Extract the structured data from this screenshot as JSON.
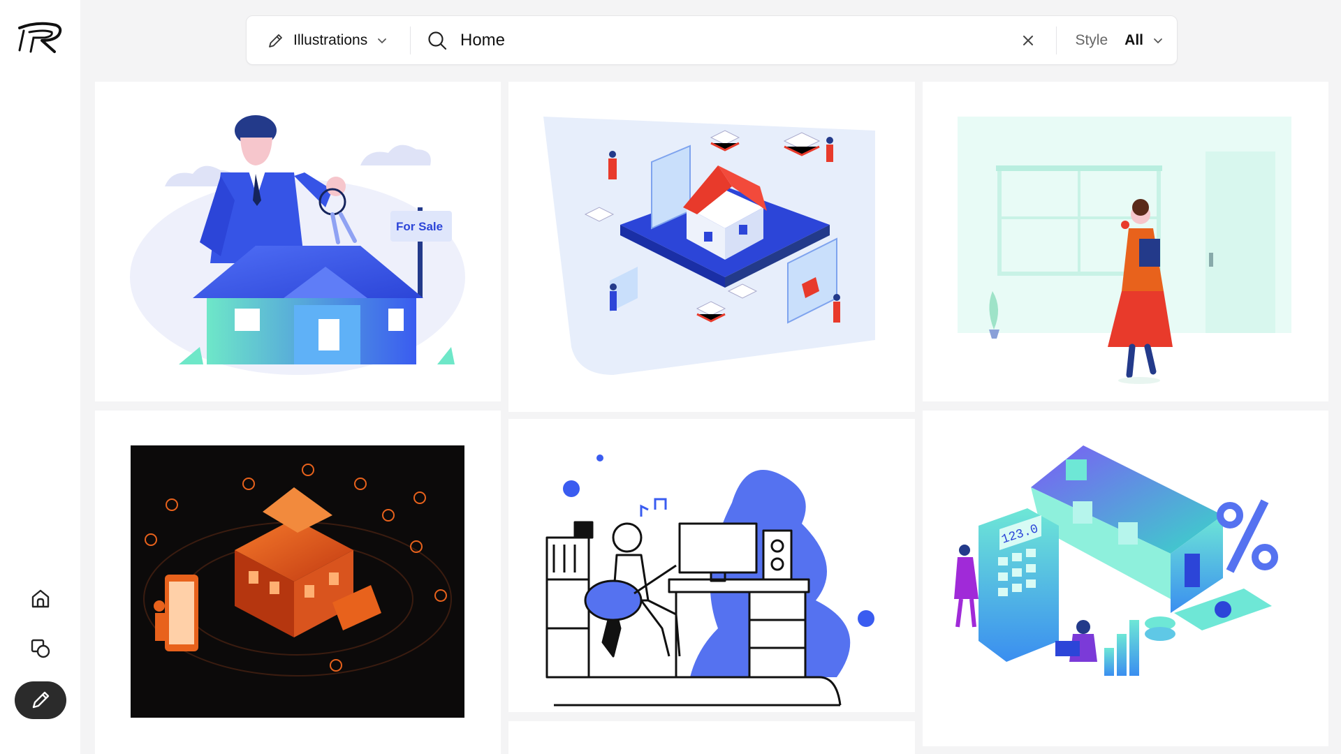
{
  "app": {
    "logo_icon": "brand-logo-icon"
  },
  "sidebar": {
    "items": [
      {
        "name": "home",
        "icon": "home-icon",
        "active": false
      },
      {
        "name": "shapes",
        "icon": "shapes-icon",
        "active": false
      },
      {
        "name": "draw",
        "icon": "pencil-icon",
        "active": true
      }
    ],
    "active_bg": "#2b2b2b"
  },
  "search": {
    "category_icon": "pencil-icon",
    "category_label": "Illustrations",
    "query": "Home",
    "style_label": "Style",
    "style_value": "All"
  },
  "results": {
    "cards": [
      {
        "id": "card-1",
        "text": "For Sale",
        "illustration": "businessman-holding-keys-house-for-sale"
      },
      {
        "id": "card-2",
        "illustration": "isometric-house-on-tablet-with-people"
      },
      {
        "id": "card-3",
        "illustration": "woman-in-red-dress-at-home-window"
      },
      {
        "id": "card-4",
        "illustration": "dark-isometric-smart-home"
      },
      {
        "id": "card-5",
        "illustration": "girl-playing-guitar-at-desk-outline"
      },
      {
        "id": "card-6",
        "text": "123.0",
        "illustration": "isometric-house-calculator-mortgage"
      },
      {
        "id": "card-7",
        "illustration": "partially-visible-card"
      }
    ]
  },
  "colors": {
    "accent_blue": "#3a5cf0",
    "accent_red": "#e83a2b",
    "accent_orange": "#e8621c",
    "background": "#f4f4f5"
  }
}
